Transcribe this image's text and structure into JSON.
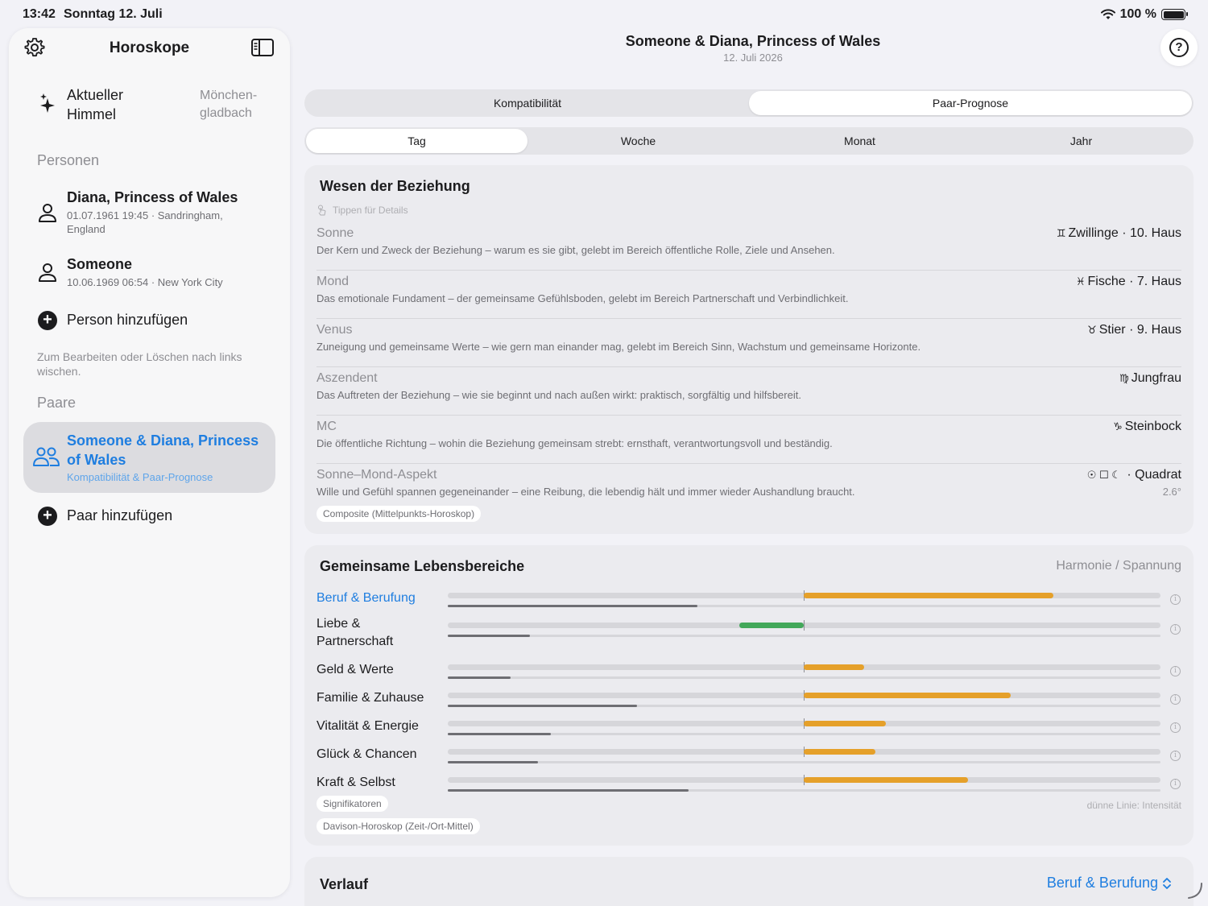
{
  "status": {
    "time": "13:42",
    "date": "Sonntag 12. Juli",
    "battery": "100 %"
  },
  "sidebar": {
    "title": "Horoskope",
    "current_sky": {
      "label": "Aktueller Himmel",
      "location": "Mönchen-gladbach"
    },
    "persons_header": "Personen",
    "persons": [
      {
        "name": "Diana, Princess of Wales",
        "meta": "01.07.1961 19:45 · Sandringham, England"
      },
      {
        "name": "Someone",
        "meta": "10.06.1969 06:54 · New York City"
      }
    ],
    "add_person": "Person hinzufügen",
    "edit_hint": "Zum Bearbeiten oder Löschen nach links wischen.",
    "pairs_header": "Paare",
    "pair": {
      "name": "Someone & Diana, Princess of Wales",
      "sub": "Kompatibilität & Paar-Prognose"
    },
    "add_pair": "Paar hinzufügen"
  },
  "header": {
    "title": "Someone & Diana, Princess of Wales",
    "date": "12. Juli 2026"
  },
  "tabs_main": [
    "Kompatibilität",
    "Paar-Prognose"
  ],
  "tabs_period": [
    "Tag",
    "Woche",
    "Monat",
    "Jahr"
  ],
  "nature": {
    "title": "Wesen der Beziehung",
    "tap_hint": "Tippen für Details",
    "items": [
      {
        "name": "Sonne",
        "glyph": "♊",
        "value": "Zwillinge · 10. Haus",
        "desc": "Der Kern und Zweck der Beziehung – warum es sie gibt, gelebt im Bereich öffentliche Rolle, Ziele und Ansehen."
      },
      {
        "name": "Mond",
        "glyph": "♓",
        "value": "Fische · 7. Haus",
        "desc": "Das emotionale Fundament – der gemeinsame Gefühlsboden, gelebt im Bereich Partnerschaft und Verbindlichkeit."
      },
      {
        "name": "Venus",
        "glyph": "♉",
        "value": "Stier · 9. Haus",
        "desc": "Zuneigung und gemeinsame Werte – wie gern man einander mag, gelebt im Bereich Sinn, Wachstum und gemeinsame Horizonte."
      },
      {
        "name": "Aszendent",
        "glyph": "♍",
        "value": "Jungfrau",
        "desc": "Das Auftreten der Beziehung – wie sie beginnt und nach außen wirkt: praktisch, sorgfältig und hilfsbereit."
      },
      {
        "name": "MC",
        "glyph": "♑",
        "value": "Steinbock",
        "desc": "Die öffentliche Richtung – wohin die Beziehung gemeinsam strebt: ernsthaft, verantwortungsvoll und beständig."
      },
      {
        "name": "Sonne–Mond-Aspekt",
        "glyph": "☉ ☐ ☾",
        "value": "· Quadrat",
        "extra": "2.6°",
        "desc": "Wille und Gefühl spannen gegeneinander – eine Reibung, die lebendig hält und immer wieder Aushandlung braucht."
      }
    ],
    "tag": "Composite (Mittelpunkts-Horoskop)"
  },
  "life": {
    "title": "Gemeinsame Lebensbereiche",
    "legend": "Harmonie / Spannung",
    "rows": [
      {
        "name": "Beruf & Berufung",
        "harmony": 0.35,
        "intensity": 0.35
      },
      {
        "name": "Liebe & Partnerschaft",
        "harmony": -0.09,
        "intensity": 0.115
      },
      {
        "name": "Geld & Werte",
        "harmony": 0.085,
        "intensity": 0.088
      },
      {
        "name": "Familie & Zuhause",
        "harmony": 0.29,
        "intensity": 0.265
      },
      {
        "name": "Vitalität & Energie",
        "harmony": 0.115,
        "intensity": 0.145
      },
      {
        "name": "Glück & Chancen",
        "harmony": 0.1,
        "intensity": 0.127
      },
      {
        "name": "Kraft & Selbst",
        "harmony": 0.23,
        "intensity": 0.338
      }
    ],
    "tag1": "Signifikatoren",
    "tag2": "Davison-Horoskop (Zeit-/Ort-Mittel)",
    "thin_hint": "dünne Linie: Intensität"
  },
  "verlauf": {
    "title": "Verlauf",
    "selector": "Beruf & Berufung"
  },
  "colors": {
    "accent": "#1f7ee0",
    "harmony": "#e5a02a",
    "tension": "#43a85a"
  }
}
